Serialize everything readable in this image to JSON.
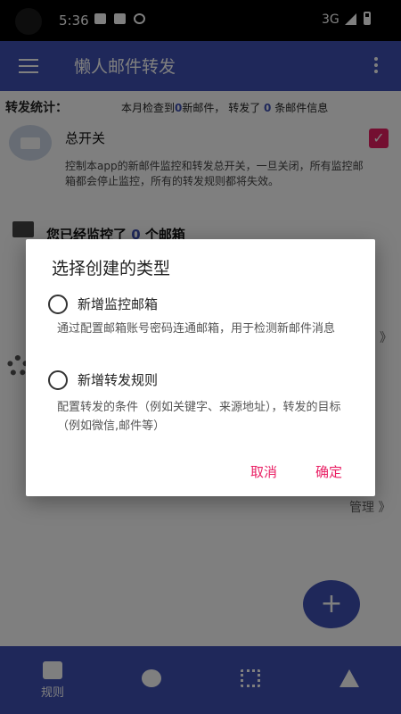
{
  "status_bar": {
    "time": "5:36",
    "network": "3G"
  },
  "app_bar": {
    "title": "懒人邮件转发"
  },
  "content": {
    "stats_label": "转发统计：",
    "stats_prefix": "本月检查到",
    "stats_new_count": "0",
    "stats_middle": "新邮件，  转发了 ",
    "stats_forward_count": "0",
    "stats_suffix": " 条邮件信息",
    "switch_title": "总开关",
    "switch_desc": "控制本app的新邮件监控和转发总开关，一旦关闭，所有监控邮箱都会停止监控，所有的转发规则都将失效。",
    "monitor_prefix": "您已经监控了 ",
    "monitor_count": "0",
    "monitor_suffix": " 个邮箱",
    "manage_link_1": "》",
    "manage_link_2": "管理 》"
  },
  "dialog": {
    "title": "选择创建的类型",
    "option1_label": "新增监控邮箱",
    "option1_desc": "通过配置邮箱账号密码连通邮箱，用于检测新邮件消息",
    "option2_label": "新增转发规则",
    "option2_desc": "配置转发的条件（例如关键字、来源地址），转发的目标（例如微信,邮件等）",
    "cancel": "取消",
    "confirm": "确定"
  },
  "bottom_nav": {
    "items": [
      {
        "label": "规则",
        "icon": "alert-icon"
      },
      {
        "label": "",
        "icon": "gear-icon"
      },
      {
        "label": "",
        "icon": "dots-icon"
      },
      {
        "label": "",
        "icon": "star-icon"
      }
    ]
  },
  "colors": {
    "primary": "#3f51b5",
    "accent": "#e91e63"
  }
}
